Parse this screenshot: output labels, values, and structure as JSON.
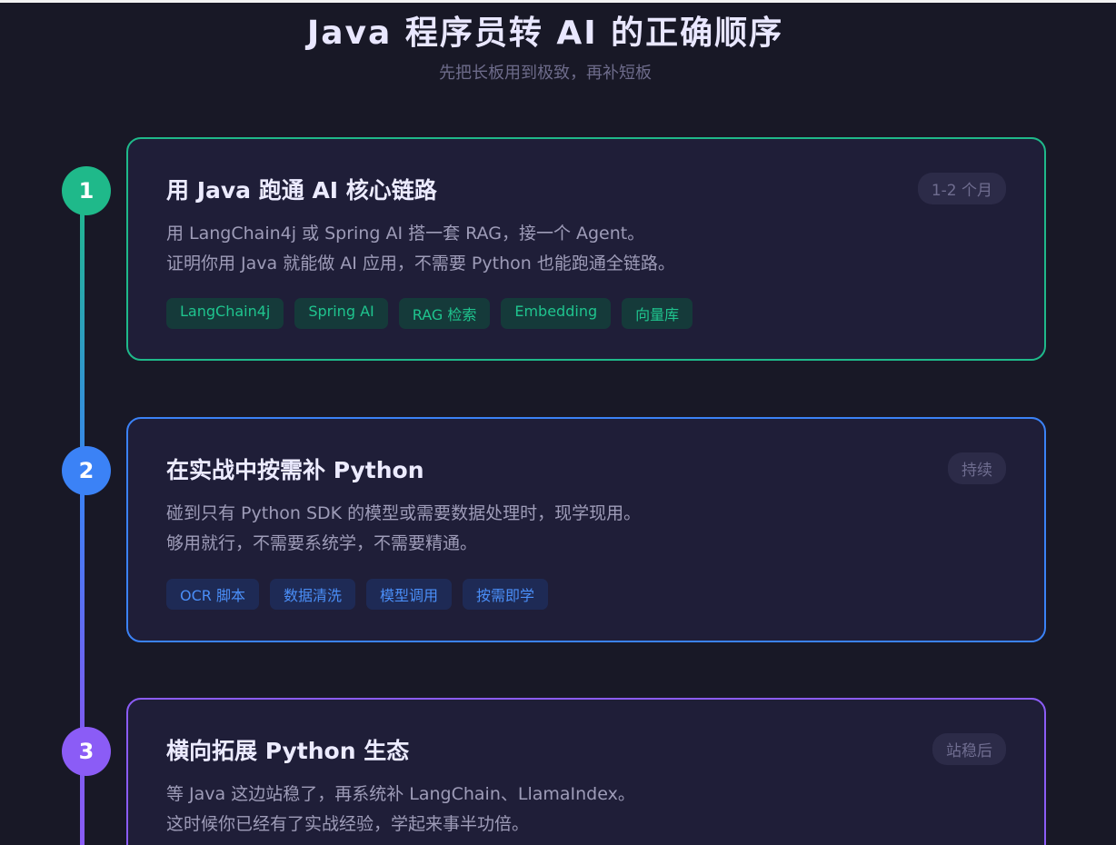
{
  "header": {
    "title": "Java 程序员转 AI 的正确顺序",
    "subtitle": "先把长板用到极致，再补短板"
  },
  "colors": {
    "background": "#181826",
    "card_background": "#1f1e38",
    "step1_accent": "#1fb98a",
    "step2_accent": "#3b82f6",
    "step3_accent": "#8b5cf6"
  },
  "steps": [
    {
      "number": "1",
      "title": "用 Java 跑通 AI 核心链路",
      "duration": "1-2 个月",
      "description": [
        "用 LangChain4j 或 Spring AI 搭一套 RAG，接一个 Agent。",
        "证明你用 Java 就能做 AI 应用，不需要 Python 也能跑通全链路。"
      ],
      "tags": [
        "LangChain4j",
        "Spring AI",
        "RAG 检索",
        "Embedding",
        "向量库"
      ]
    },
    {
      "number": "2",
      "title": "在实战中按需补 Python",
      "duration": "持续",
      "description": [
        "碰到只有 Python SDK 的模型或需要数据处理时，现学现用。",
        "够用就行，不需要系统学，不需要精通。"
      ],
      "tags": [
        "OCR 脚本",
        "数据清洗",
        "模型调用",
        "按需即学"
      ]
    },
    {
      "number": "3",
      "title": "横向拓展 Python 生态",
      "duration": "站稳后",
      "description": [
        "等 Java 这边站稳了，再系统补 LangChain、LlamaIndex。",
        "这时候你已经有了实战经验，学起来事半功倍。"
      ],
      "tags": []
    }
  ]
}
